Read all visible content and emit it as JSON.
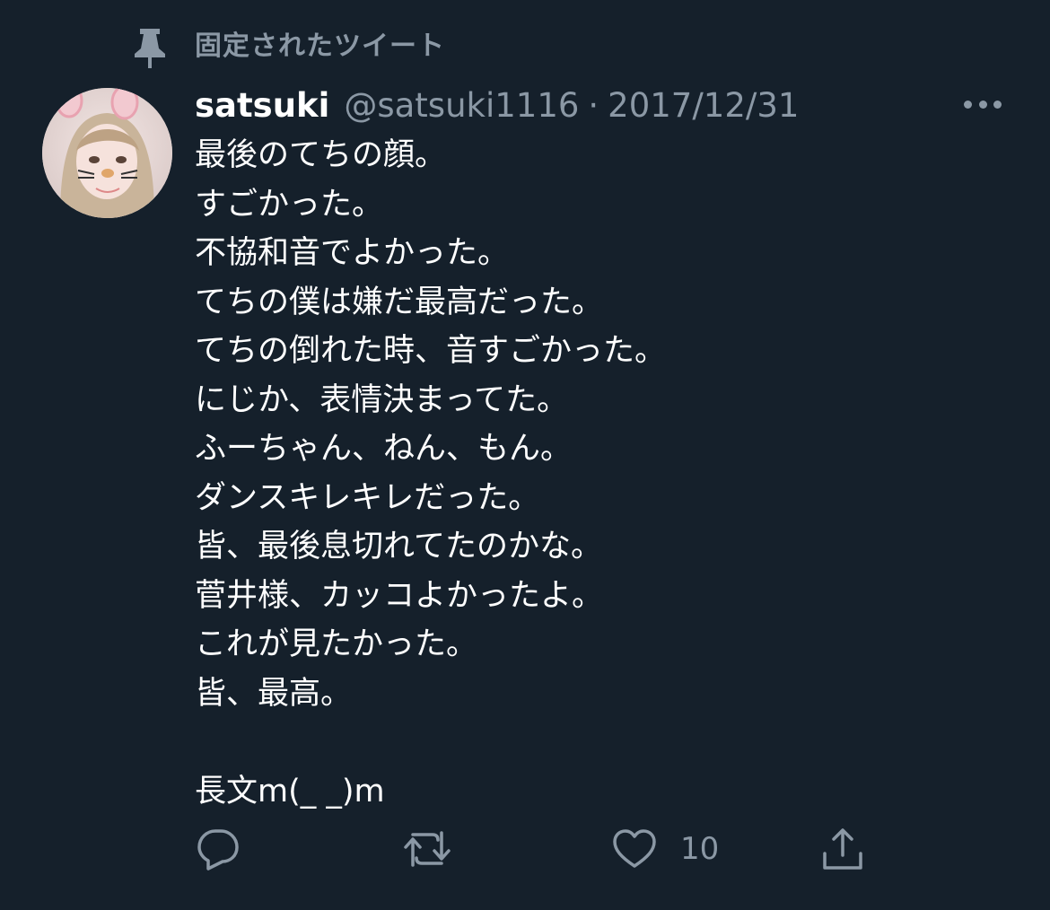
{
  "pinned": {
    "label": "固定されたツイート",
    "icon": "pin-icon"
  },
  "tweet": {
    "display_name": "satsuki",
    "handle": "@satsuki1116",
    "separator": "·",
    "date": "2017/12/31",
    "avatar_icon": "avatar",
    "more_icon": "more-icon",
    "lines": [
      "最後のてちの顔。",
      "すごかった。",
      "不協和音でよかった。",
      "てちの僕は嫌だ最高だった。",
      "てちの倒れた時、音すごかった。",
      "にじか、表情決まってた。",
      "ふーちゃん、ねん、もん。",
      "ダンスキレキレだった。",
      "皆、最後息切れてたのかな。",
      "菅井様、カッコよかったよ。",
      "これが見たかった。",
      "皆、最高。",
      "",
      "長文m(_ _)m"
    ]
  },
  "actions": {
    "reply_icon": "reply-icon",
    "retweet_icon": "retweet-icon",
    "like_icon": "heart-icon",
    "like_count": "10",
    "share_icon": "share-icon"
  },
  "colors": {
    "background": "#15202b",
    "text": "#ffffff",
    "secondary": "#8b98a5"
  }
}
